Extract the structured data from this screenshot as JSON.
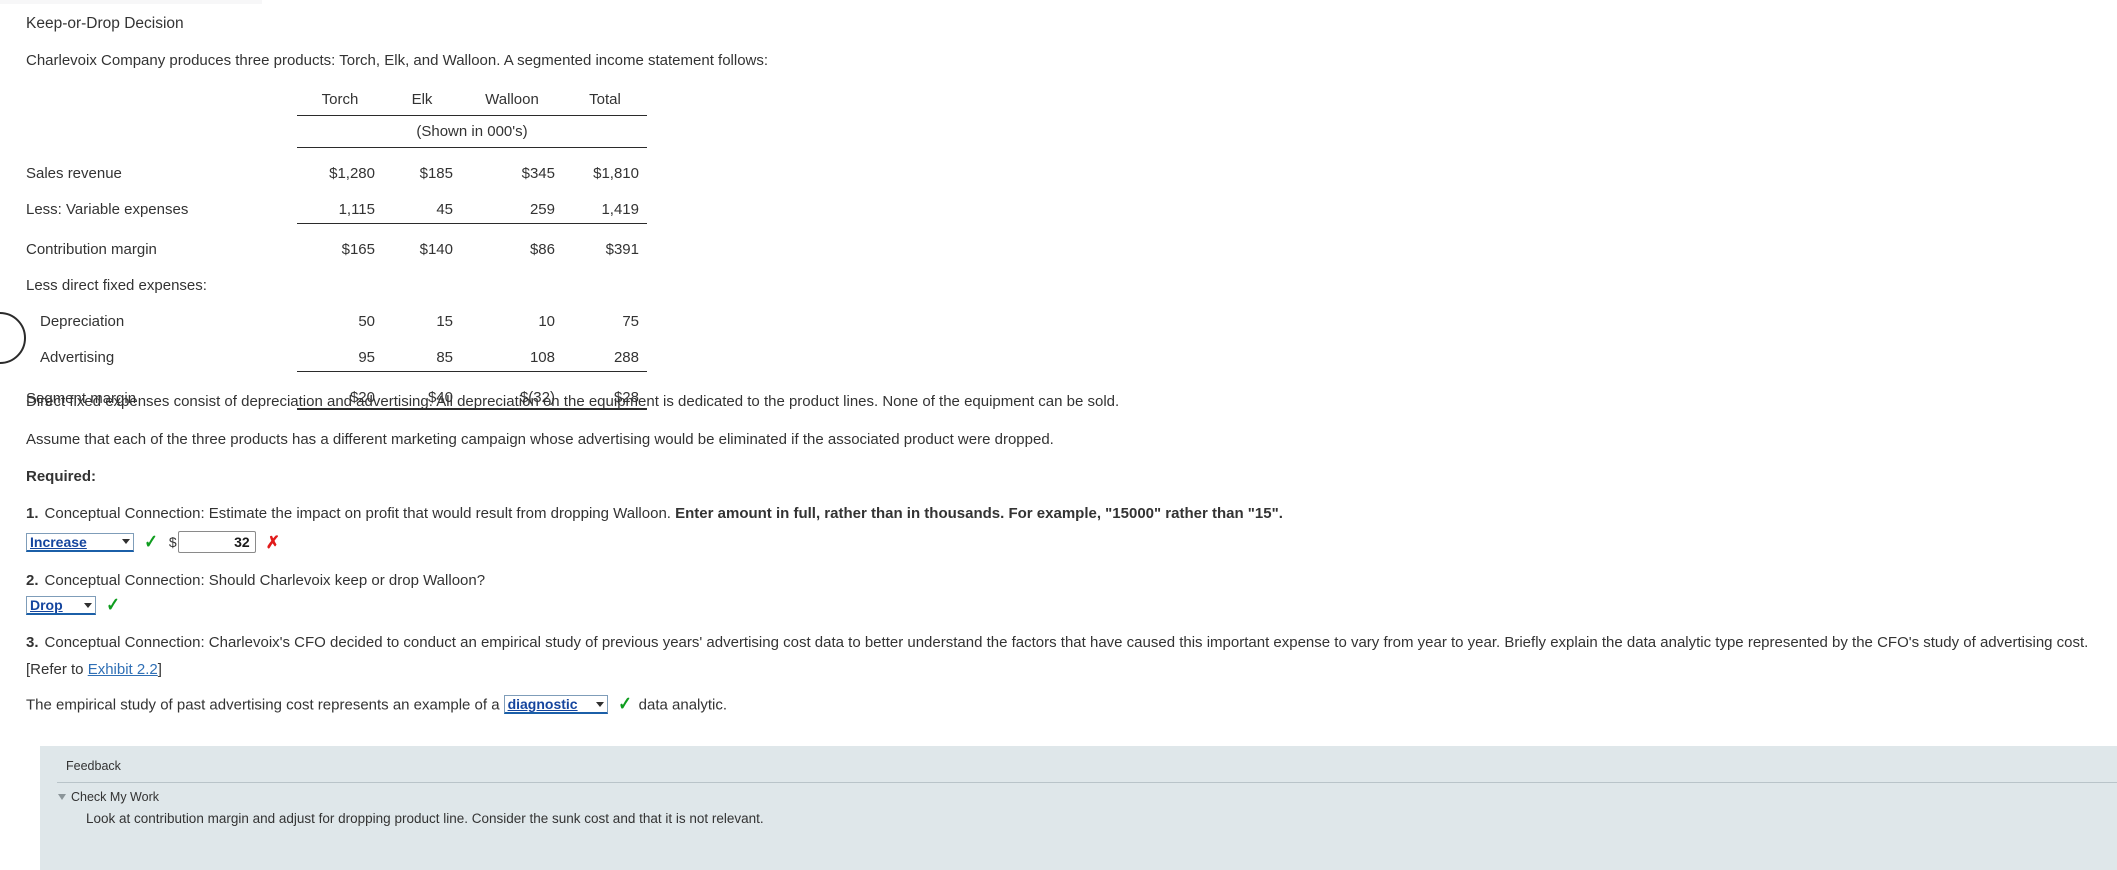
{
  "document": {
    "heading": "Keep-or-Drop Decision",
    "intro": "Charlevoix Company produces three products: Torch, Elk, and Walloon. A segmented income statement follows:"
  },
  "table": {
    "columns": [
      "",
      "Torch",
      "Elk",
      "Walloon",
      "Total"
    ],
    "units_note": "(Shown in 000's)",
    "rows": [
      {
        "label": "Sales revenue",
        "torch": "$1,280",
        "elk": "$185",
        "walloon": "$345",
        "total": "$1,810"
      },
      {
        "label": "Less: Variable expenses",
        "torch": "1,115",
        "elk": "45",
        "walloon": "259",
        "total": "1,419"
      },
      {
        "label": "Contribution margin",
        "torch": "$165",
        "elk": "$140",
        "walloon": "$86",
        "total": "$391"
      },
      {
        "label": "Less direct fixed expenses:",
        "torch": "",
        "elk": "",
        "walloon": "",
        "total": ""
      },
      {
        "label": "Depreciation",
        "torch": "50",
        "elk": "15",
        "walloon": "10",
        "total": "75"
      },
      {
        "label": "Advertising",
        "torch": "95",
        "elk": "85",
        "walloon": "108",
        "total": "288"
      },
      {
        "label": "Segment margin",
        "torch": "$20",
        "elk": "$40",
        "walloon": "$(32)",
        "total": "$28"
      }
    ]
  },
  "notes": {
    "direct_fixed": "Direct fixed expenses consist of depreciation and advertising. All depreciation on the equipment is dedicated to the product lines. None of the equipment can be sold.",
    "assume": "Assume that each of the three products has a different marketing campaign whose advertising would be eliminated if the associated product were dropped.",
    "required_label": "Required:"
  },
  "questions": {
    "q1": {
      "number": "1.",
      "text": "Conceptual Connection: Estimate the impact on profit that would result from dropping Walloon. ",
      "bold_text": "Enter amount in full, rather than in thousands. For example, \"15000\" rather than \"15\".",
      "dropdown_value": "Increase",
      "dropdown_status": "correct",
      "dollar_sign": "$",
      "amount_value": "32",
      "amount_status": "incorrect"
    },
    "q2": {
      "number": "2.",
      "text": "Conceptual Connection: Should Charlevoix keep or drop Walloon?",
      "dropdown_value": "Drop",
      "dropdown_status": "correct"
    },
    "q3": {
      "number": "3.",
      "text": "Conceptual Connection: Charlevoix's CFO decided to conduct an empirical study of previous years' advertising cost data to better understand the factors that have caused this important expense to vary from year to year. Briefly explain the data analytic type represented by the CFO's study of advertising cost.",
      "refer_prefix": "[Refer to ",
      "refer_link": "Exhibit 2.2",
      "refer_suffix": "]",
      "answer_prefix": "The empirical study of past advertising cost represents an example of a",
      "dropdown_value": "diagnostic",
      "dropdown_status": "correct",
      "answer_suffix": "data analytic."
    }
  },
  "marks": {
    "correct_glyph": "✓",
    "incorrect_glyph": "✗"
  },
  "feedback": {
    "title": "Feedback",
    "check_my_work_label": "Check My Work",
    "body": "Look at contribution margin and adjust for dropping product line. Consider the sunk cost and that it is not relevant."
  },
  "colors": {
    "correct": "#0f9d1f",
    "incorrect": "#e11b1b",
    "dropdown_text": "#15459e",
    "link": "#2f6fb5",
    "feedback_bg": "#dfe7ea"
  }
}
